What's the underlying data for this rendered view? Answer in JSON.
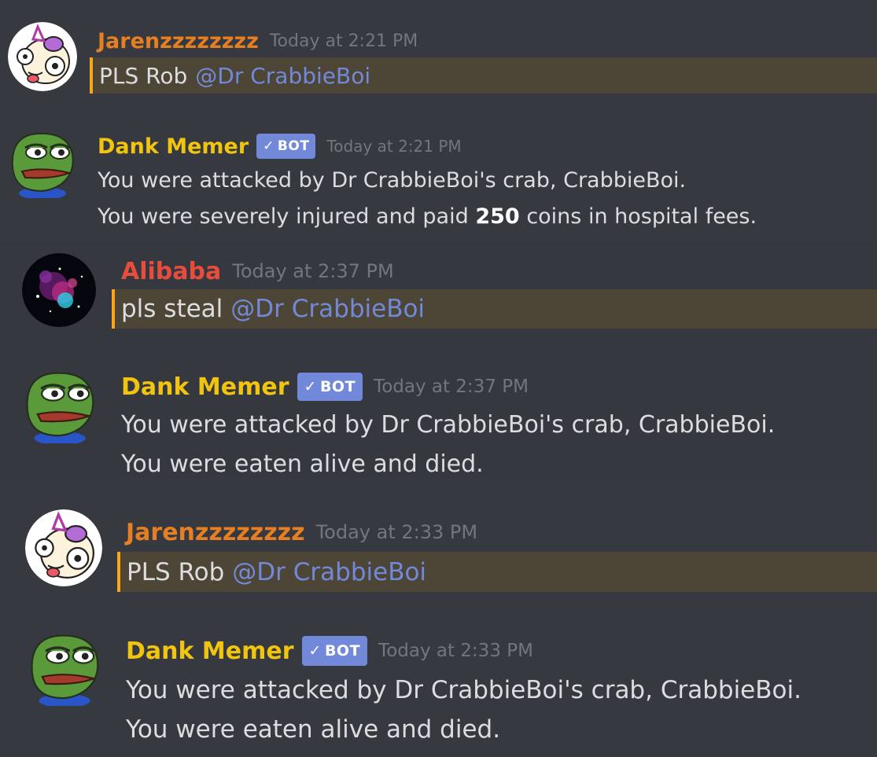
{
  "messages": [
    {
      "author": "Jarenzzzzzzzz",
      "timestamp": "Today at 2:21 PM",
      "text": "PLS Rob",
      "mention": "@Dr CrabbieBoi",
      "is_mentioning_me": true
    },
    {
      "author": "Dank Memer",
      "bot_tag": "BOT",
      "timestamp": "Today at 2:21 PM",
      "lines": [
        "You were attacked by Dr CrabbieBoi's crab, CrabbieBoi."
      ],
      "line2_before": "You were severely injured and paid",
      "line2_bold": "250",
      "line2_after": "coins in hospital fees."
    },
    {
      "author": "Alibaba",
      "timestamp": "Today at 2:37 PM",
      "text": "pls steal",
      "mention": "@Dr CrabbieBoi",
      "is_mentioning_me": true
    },
    {
      "author": "Dank Memer",
      "bot_tag": "BOT",
      "timestamp": "Today at 2:37 PM",
      "lines": [
        "You were attacked by Dr CrabbieBoi's crab, CrabbieBoi.",
        "You were eaten alive and died."
      ]
    },
    {
      "author": "Jarenzzzzzzzz",
      "timestamp": "Today at 2:33 PM",
      "text": "PLS Rob",
      "mention": "@Dr CrabbieBoi",
      "is_mentioning_me": true
    },
    {
      "author": "Dank Memer",
      "bot_tag": "BOT",
      "timestamp": "Today at 2:33 PM",
      "lines": [
        "You were attacked by Dr CrabbieBoi's crab, CrabbieBoi.",
        "You were eaten alive and died."
      ]
    }
  ],
  "icons": {
    "verified_check": "✓",
    "avatar_jaren": "unicorn-avatar-icon",
    "avatar_dank": "pepe-frog-avatar-icon",
    "avatar_alibaba": "galaxy-avatar-icon"
  },
  "colors": {
    "background": "#36393f",
    "mention_highlight": "#4d4637",
    "mention_bar": "#faa61a",
    "mention_text": "#7289da",
    "bot_tag": "#7289da",
    "author_jaren": "#e67e22",
    "author_dank": "#f1c40f",
    "author_alibaba": "#e74c3c",
    "message_text": "#dcddde",
    "timestamp": "#72767d"
  }
}
